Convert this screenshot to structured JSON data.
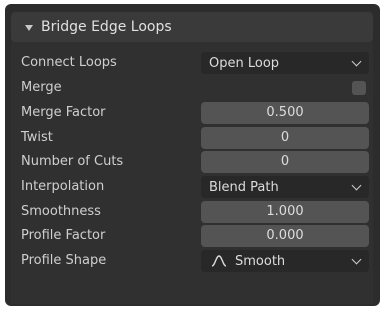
{
  "panel": {
    "title": "Bridge Edge Loops"
  },
  "fields": {
    "connect_loops": {
      "label": "Connect Loops",
      "value": "Open Loop"
    },
    "merge": {
      "label": "Merge",
      "checked": false
    },
    "merge_factor": {
      "label": "Merge Factor",
      "value": "0.500"
    },
    "twist": {
      "label": "Twist",
      "value": "0"
    },
    "number_of_cuts": {
      "label": "Number of Cuts",
      "value": "0"
    },
    "interpolation": {
      "label": "Interpolation",
      "value": "Blend Path"
    },
    "smoothness": {
      "label": "Smoothness",
      "value": "1.000"
    },
    "profile_factor": {
      "label": "Profile Factor",
      "value": "0.000"
    },
    "profile_shape": {
      "label": "Profile Shape",
      "value": "Smooth",
      "icon": "smooth-curve-icon"
    }
  },
  "colors": {
    "panel_bg": "#303030",
    "header_bg": "#3a3a3a",
    "numeric_field_bg": "#545454",
    "dropdown_bg": "#282828",
    "text": "#cfcfcf"
  }
}
